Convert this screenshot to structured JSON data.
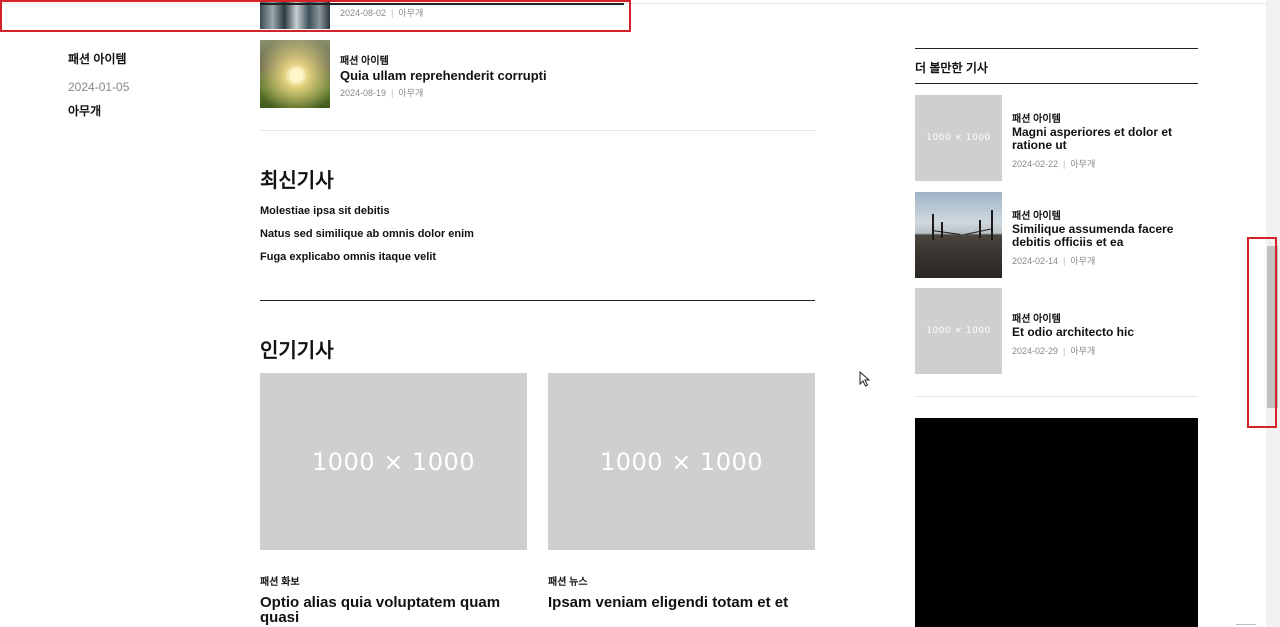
{
  "left_meta": {
    "category": "패션 아이템",
    "date": "2024-01-05",
    "author": "아무개"
  },
  "related": [
    {
      "date": "2024-08-02",
      "author": "아무개"
    },
    {
      "category": "패션 아이템",
      "title": "Quia ullam reprehenderit corrupti",
      "date": "2024-08-19",
      "author": "아무개"
    }
  ],
  "latest": {
    "heading": "최신기사",
    "items": [
      "Molestiae ipsa sit debitis",
      "Natus sed similique ab omnis dolor enim",
      "Fuga explicabo omnis itaque velit"
    ]
  },
  "popular": {
    "heading": "인기기사",
    "items": [
      {
        "placeholder": "1000 × 1000",
        "category": "패션 화보",
        "title": "Optio alias quia voluptatem quam quasi"
      },
      {
        "placeholder": "1000 × 1000",
        "category": "패션 뉴스",
        "title": "Ipsam veniam eligendi totam et et"
      }
    ]
  },
  "sidebar": {
    "heading": "더 볼만한 기사",
    "items": [
      {
        "placeholder": "1000 × 1000",
        "category": "패션 아이템",
        "title": "Magni asperiores et dolor et ratione ut",
        "date": "2024-02-22",
        "author": "아무개"
      },
      {
        "category": "패션 아이템",
        "title": "Similique assumenda facere debitis officiis et ea",
        "date": "2024-02-14",
        "author": "아무개"
      },
      {
        "placeholder": "1000 × 1000",
        "category": "패션 아이템",
        "title": "Et odio architecto hic",
        "date": "2024-02-29",
        "author": "아무개"
      }
    ]
  },
  "colors": {
    "annotation_red": "#d2232a",
    "placeholder_gray": "#cfcfcf"
  }
}
